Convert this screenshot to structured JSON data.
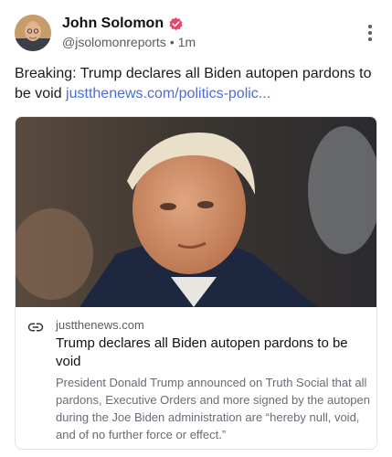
{
  "author": {
    "name": "John Solomon",
    "handle": "@jsolomonreports",
    "separator": "•",
    "time": "1m",
    "verified_color": "#e8456b"
  },
  "post": {
    "text": "Breaking: Trump declares all Biden autopen pardons to be void ",
    "link_text": "justthenews.com/politics-polic..."
  },
  "link_card": {
    "domain": "justthenews.com",
    "title": "Trump declares all Biden autopen pardons to be void",
    "description": "President Donald Trump announced on Truth Social that all pardons, Executive Orders and more signed by the autopen during the Joe Biden administration are “hereby null, void, and of no further force or effect.”"
  },
  "icons": {
    "verified": "verified-badge-icon",
    "more": "more-vertical-icon",
    "link": "link-icon"
  },
  "colors": {
    "link": "#4b6bd8",
    "secondary_text": "#5b5b66",
    "card_border": "#e3e3e8"
  }
}
